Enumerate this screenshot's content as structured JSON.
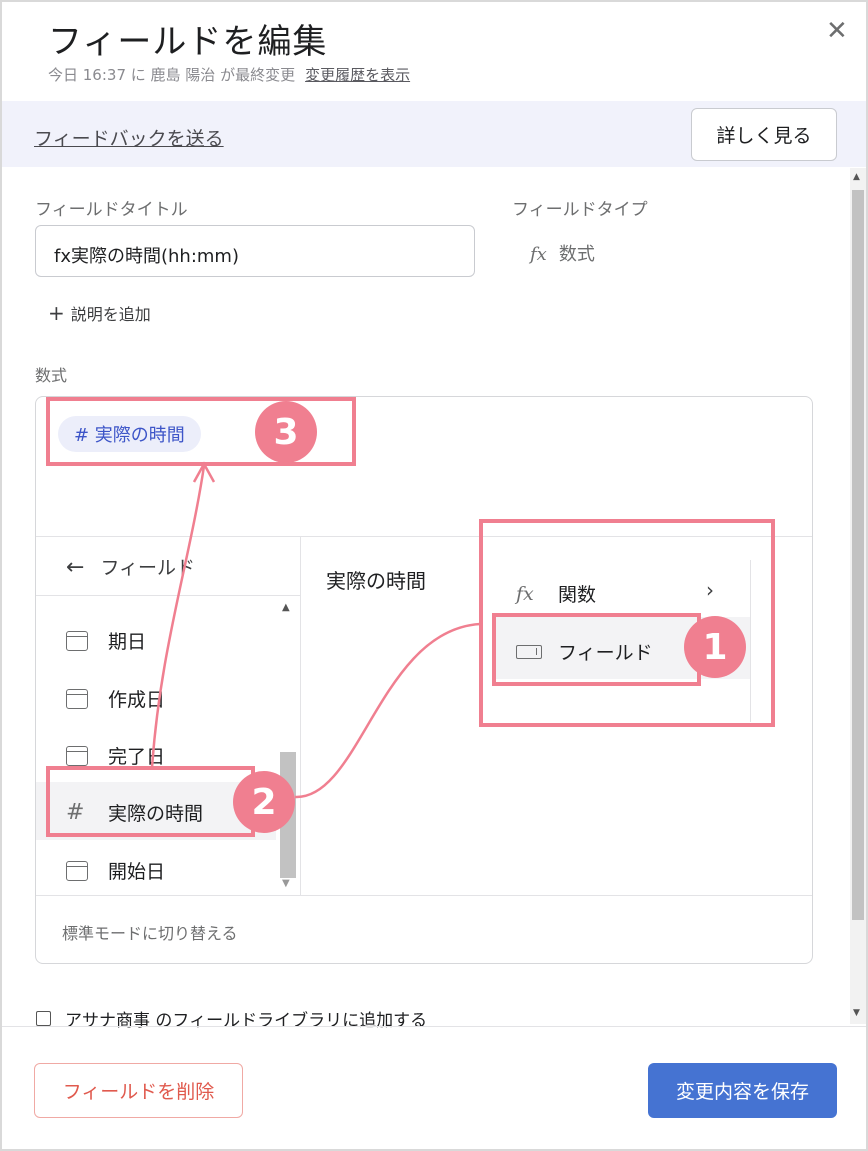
{
  "header": {
    "title": "フィールドを編集",
    "subtitle": "今日 16:37 に 鹿島 陽治 が最終変更",
    "history_link": "変更履歴を表示",
    "close_icon": "close-icon"
  },
  "banner": {
    "feedback_link": "フィードバックを送る",
    "more_button": "詳しく見る"
  },
  "form": {
    "field_title_label": "フィールドタイトル",
    "field_title_value": "fx実際の時間(hh:mm)",
    "field_type_label": "フィールドタイプ",
    "field_type_icon": "fx",
    "field_type_value": "数式",
    "add_description": "説明を追加",
    "formula_label": "数式",
    "formula_chip": "# 実際の時間"
  },
  "picker": {
    "back_label": "フィールド",
    "items": [
      {
        "icon": "calendar-icon",
        "label": "期日"
      },
      {
        "icon": "calendar-icon",
        "label": "作成日"
      },
      {
        "icon": "calendar-icon",
        "label": "完了日"
      },
      {
        "icon": "hash-icon",
        "label": "実際の時間"
      },
      {
        "icon": "calendar-icon",
        "label": "開始日"
      }
    ],
    "hash_symbol": "#",
    "preview_title": "実際の時間",
    "menu": [
      {
        "icon": "fx",
        "label": "関数"
      },
      {
        "icon": "field-icon",
        "label": "フィールド"
      }
    ],
    "standard_mode": "標準モードに切り替える"
  },
  "library_checkbox": {
    "label": "アサナ商事 のフィールドライブラリに追加する",
    "checked": false
  },
  "footer": {
    "delete_button": "フィールドを削除",
    "save_button": "変更内容を保存"
  },
  "annotations": {
    "badge_1": "1",
    "badge_2": "2",
    "badge_3": "3",
    "highlight_color": "#f07f90"
  },
  "colors": {
    "accent": "#4573d2",
    "danger": "#e05a4e",
    "chip_text": "#3d55c8"
  }
}
